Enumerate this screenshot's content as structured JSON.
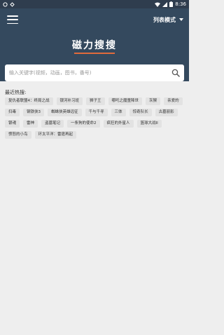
{
  "status_bar": {
    "time": "8:36"
  },
  "header": {
    "view_mode_label": "列表模式",
    "title": "磁力搜搜",
    "accent_color": "#e06a3c",
    "background_color": "#34495e"
  },
  "search": {
    "placeholder": "输入关键字(视频，动画，图书，番号)",
    "value": ""
  },
  "recent": {
    "label": "最近热搜:",
    "tags": [
      "复仇者联盟4：终局之战",
      "银河补习班",
      "狮子王",
      "哪吒之魔童降世",
      "灰猴",
      "亲爱的",
      "扫毒",
      "钢铁侠3",
      "蜘蛛侠英雄远征",
      "千与千寻",
      "三体",
      "惊奇队长",
      "古墓丽影",
      "银魂",
      "雷神",
      "盗墓笔记",
      "一条狗的使命2",
      "疯狂的外星人",
      "篮球大战II",
      "愤怒的小鸟",
      "环太平洋：雷霆再起"
    ]
  }
}
